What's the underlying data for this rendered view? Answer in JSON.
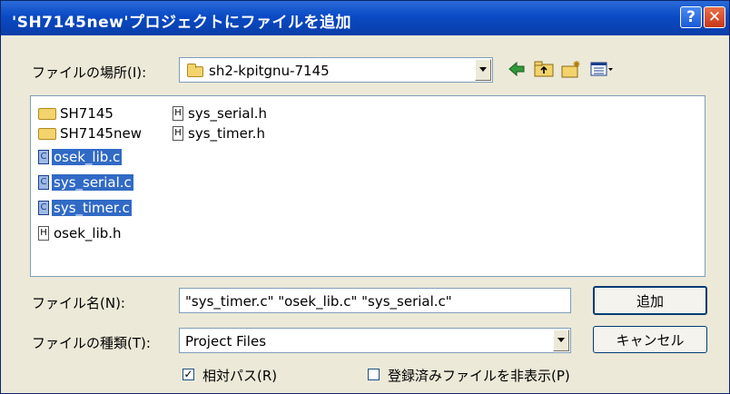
{
  "window": {
    "title": "'SH7145new'プロジェクトにファイルを追加",
    "help_glyph": "?",
    "close_glyph": "✕"
  },
  "location": {
    "label": "ファイルの場所(I):",
    "value": "sh2-kpitgnu-7145"
  },
  "toolbar": {
    "back_icon": "arrow-left-icon",
    "up_icon": "folder-up-icon",
    "new_folder_icon": "new-folder-icon",
    "view_icon": "view-menu-icon"
  },
  "files": {
    "col1": [
      {
        "name": "SH7145",
        "type": "folder",
        "selected": false
      },
      {
        "name": "SH7145new",
        "type": "folder",
        "selected": false
      },
      {
        "name": "osek_lib.c",
        "type": "c",
        "selected": true
      },
      {
        "name": "sys_serial.c",
        "type": "c",
        "selected": true
      },
      {
        "name": "sys_timer.c",
        "type": "c",
        "selected": true
      },
      {
        "name": "osek_lib.h",
        "type": "h",
        "selected": false
      }
    ],
    "col2": [
      {
        "name": "sys_serial.h",
        "type": "h",
        "selected": false
      },
      {
        "name": "sys_timer.h",
        "type": "h",
        "selected": false
      }
    ]
  },
  "filename": {
    "label": "ファイル名(N):",
    "value": "\"sys_timer.c\" \"osek_lib.c\" \"sys_serial.c\""
  },
  "filetype": {
    "label": "ファイルの種類(T):",
    "value": "Project Files"
  },
  "buttons": {
    "add_label": "追加",
    "cancel_label": "キャンセル"
  },
  "options": {
    "relative_path_label": "相対パス(R)",
    "relative_path_checked": true,
    "hide_registered_label": "登録済みファイルを非表示(P)",
    "hide_registered_checked": false
  },
  "colors": {
    "title_bar": "#0a4ac4",
    "dialog_bg": "#ece9d8",
    "selection": "#316ac5"
  }
}
